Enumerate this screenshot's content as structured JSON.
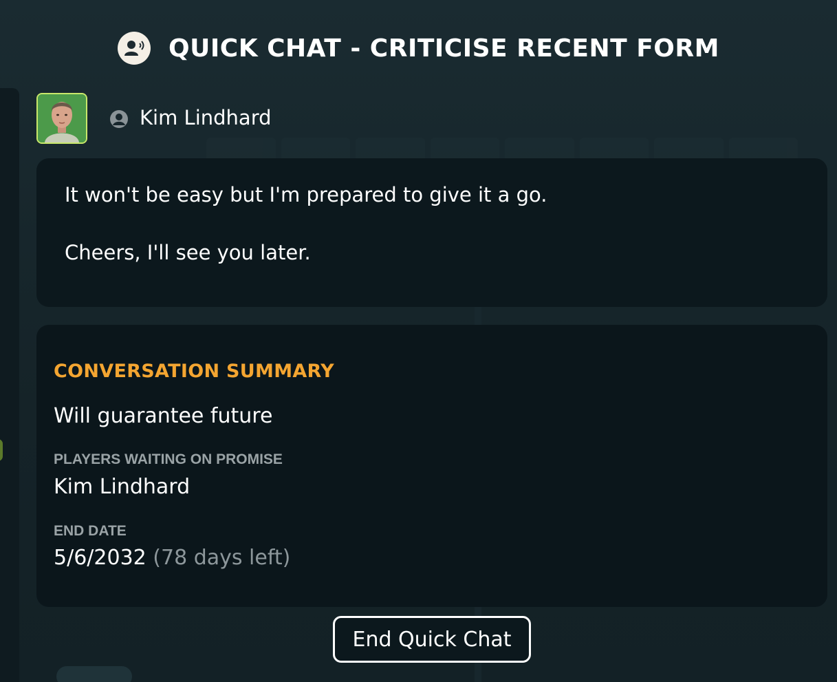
{
  "header": {
    "title": "QUICK CHAT - CRITICISE RECENT FORM",
    "icon": "quick-chat-icon"
  },
  "speaker": {
    "name": "Kim Lindhard",
    "avatar_icon": "player-face",
    "person_icon": "person-icon"
  },
  "message": {
    "lines": [
      "It won't be easy but I'm prepared to give it a go.",
      "Cheers, I'll see you later."
    ]
  },
  "summary": {
    "heading": "CONVERSATION SUMMARY",
    "outcome": "Will guarantee future",
    "players_label": "PLAYERS WAITING ON PROMISE",
    "players_value": "Kim Lindhard",
    "end_date_label": "END DATE",
    "end_date_value": "5/6/2032",
    "days_left": "(78 days left)"
  },
  "actions": {
    "end_label": "End Quick Chat"
  },
  "colors": {
    "background": "#17262c",
    "panel": "#0c181d",
    "accent_heading": "#f4a531",
    "muted_label": "#9aa3a6",
    "avatar_border": "#c9e86a"
  }
}
